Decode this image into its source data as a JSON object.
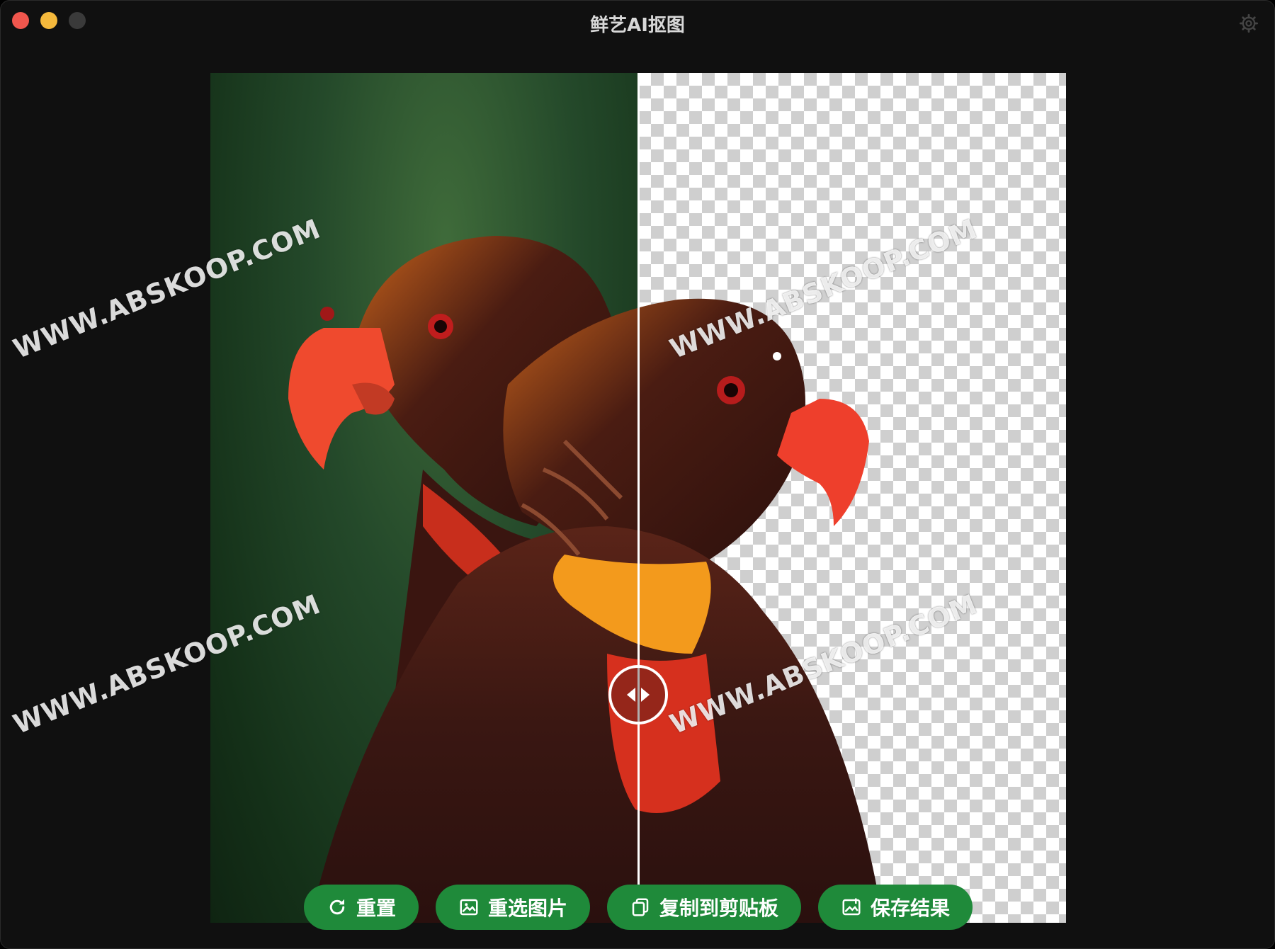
{
  "window": {
    "title": "鲜艺AI抠图"
  },
  "toolbar": {
    "reset_label": "重置",
    "reselect_label": "重选图片",
    "copy_label": "复制到剪贴板",
    "save_label": "保存结果"
  },
  "watermark": "WWW.ABSKOOP.COM",
  "colors": {
    "accent_button": "#1f8a3a",
    "traffic_close": "#f0564d",
    "traffic_minimize": "#f5b93c"
  }
}
